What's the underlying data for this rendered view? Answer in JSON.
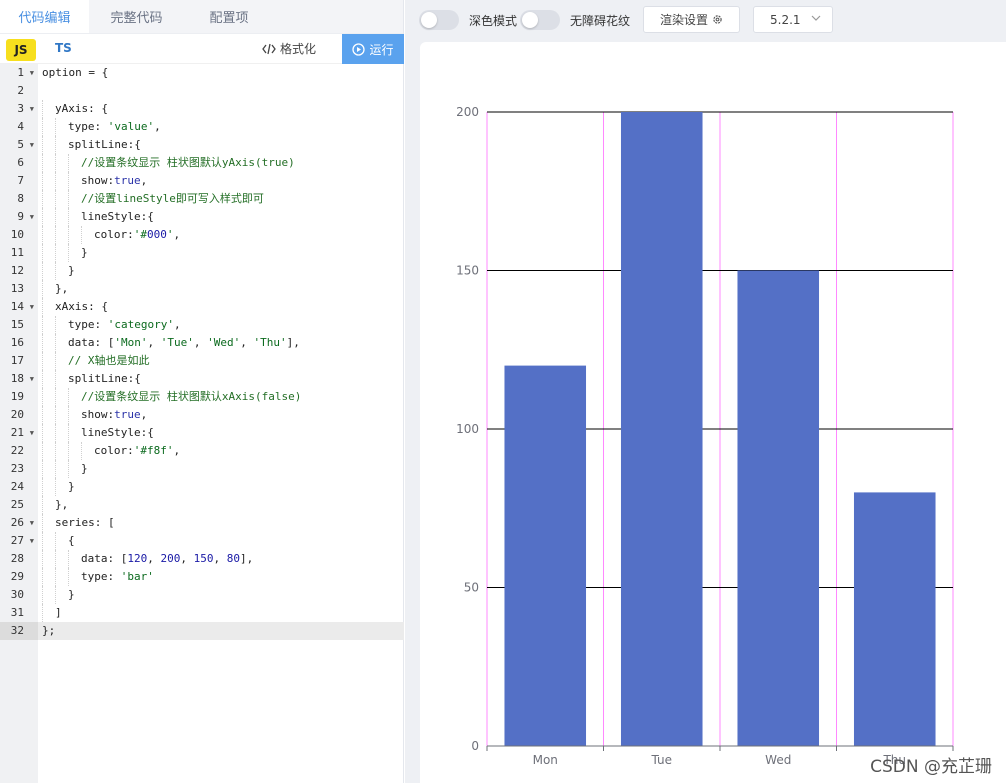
{
  "tabs": [
    {
      "label": "代码编辑"
    },
    {
      "label": "完整代码"
    },
    {
      "label": "配置项"
    }
  ],
  "lang": {
    "js": "JS",
    "ts": "TS"
  },
  "toolbar": {
    "format_label": "格式化",
    "run_label": "运行"
  },
  "code_lines": [
    "option = {",
    "",
    "  yAxis: {",
    "    type: 'value',",
    "    splitLine:{",
    "      //设置条纹显示 柱状图默认yAxis(true)",
    "      show:true,",
    "      //设置lineStyle即可写入样式即可",
    "      lineStyle:{",
    "        color:'#000',",
    "      }",
    "    }",
    "  },",
    "  xAxis: {",
    "    type: 'category',",
    "    data: ['Mon', 'Tue', 'Wed', 'Thu'],",
    "    // X轴也是如此",
    "    splitLine:{",
    "      //设置条纹显示 柱状图默认xAxis(false)",
    "      show:true,",
    "      lineStyle:{",
    "        color:'#f8f',",
    "      }",
    "    }",
    "  },",
    "  series: [",
    "    {",
    "      data: [120, 200, 150, 80],",
    "      type: 'bar'",
    "    }",
    "  ]",
    "};"
  ],
  "fold_lines": [
    1,
    3,
    5,
    9,
    14,
    18,
    21,
    26,
    27
  ],
  "active_line": 32,
  "right_toolbar": {
    "dark_mode_label": "深色模式",
    "decal_label": "无障碍花纹",
    "render_settings_label": "渲染设置",
    "version": "5.2.1"
  },
  "chart_data": {
    "type": "bar",
    "categories": [
      "Mon",
      "Tue",
      "Wed",
      "Thu"
    ],
    "values": [
      120,
      200,
      150,
      80
    ],
    "ylim": [
      0,
      200
    ],
    "yticks": [
      0,
      50,
      100,
      150,
      200
    ],
    "y_split_color": "#000000",
    "x_split_color": "#ff88ff",
    "bar_color": "#5470c6",
    "grid": true
  },
  "watermark": "CSDN @充芷珊"
}
